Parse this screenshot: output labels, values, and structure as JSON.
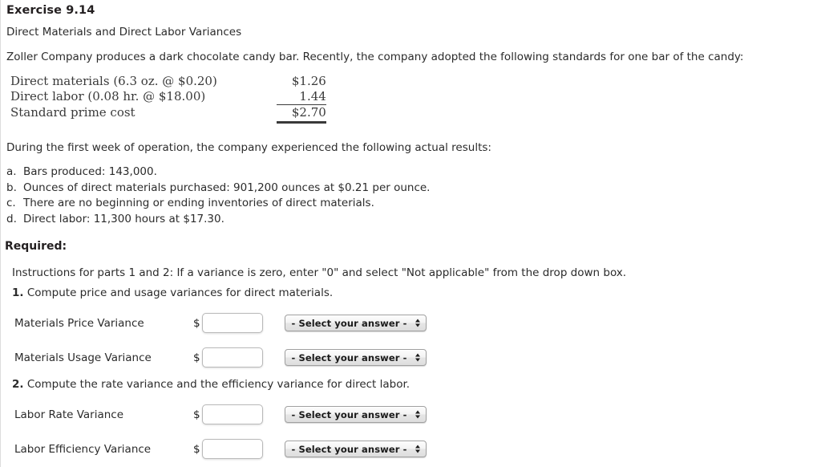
{
  "exercise": {
    "title": "Exercise 9.14",
    "subtitle": "Direct Materials and Direct Labor Variances",
    "intro": "Zoller Company produces a dark chocolate candy bar. Recently, the company adopted the following standards for one bar of the candy:"
  },
  "standards": {
    "rows": [
      {
        "description": "Direct materials (6.3 oz. @ $0.20)",
        "amount": "$1.26"
      },
      {
        "description": "Direct labor (0.08 hr. @ $18.00)",
        "amount": "1.44"
      },
      {
        "description": "Standard prime cost",
        "amount": "$2.70"
      }
    ]
  },
  "actual_results": {
    "lead_in": "During the first week of operation, the company experienced the following actual results:",
    "items": [
      {
        "marker": "a.",
        "text": "Bars produced: 143,000."
      },
      {
        "marker": "b.",
        "text": "Ounces of direct materials purchased: 901,200 ounces at $0.21 per ounce."
      },
      {
        "marker": "c.",
        "text": "There are no beginning or ending inventories of direct materials."
      },
      {
        "marker": "d.",
        "text": "Direct labor: 11,300 hours at $17.30."
      }
    ]
  },
  "required": {
    "heading": "Required:",
    "instructions": "Instructions for parts 1 and 2: If a variance is zero, enter \"0\" and select \"Not applicable\" from the drop down box.",
    "step1_number": "1.",
    "step1_text": "Compute price and usage variances for direct materials.",
    "step2_number": "2.",
    "step2_text": "Compute the rate variance and the efficiency variance for direct labor."
  },
  "form": {
    "currency_symbol": "$",
    "select_placeholder": "- Select your answer -",
    "rows": [
      {
        "label": "Materials Price Variance",
        "value": ""
      },
      {
        "label": "Materials Usage Variance",
        "value": ""
      },
      {
        "label": "Labor Rate Variance",
        "value": ""
      },
      {
        "label": "Labor Efficiency Variance",
        "value": ""
      }
    ]
  }
}
